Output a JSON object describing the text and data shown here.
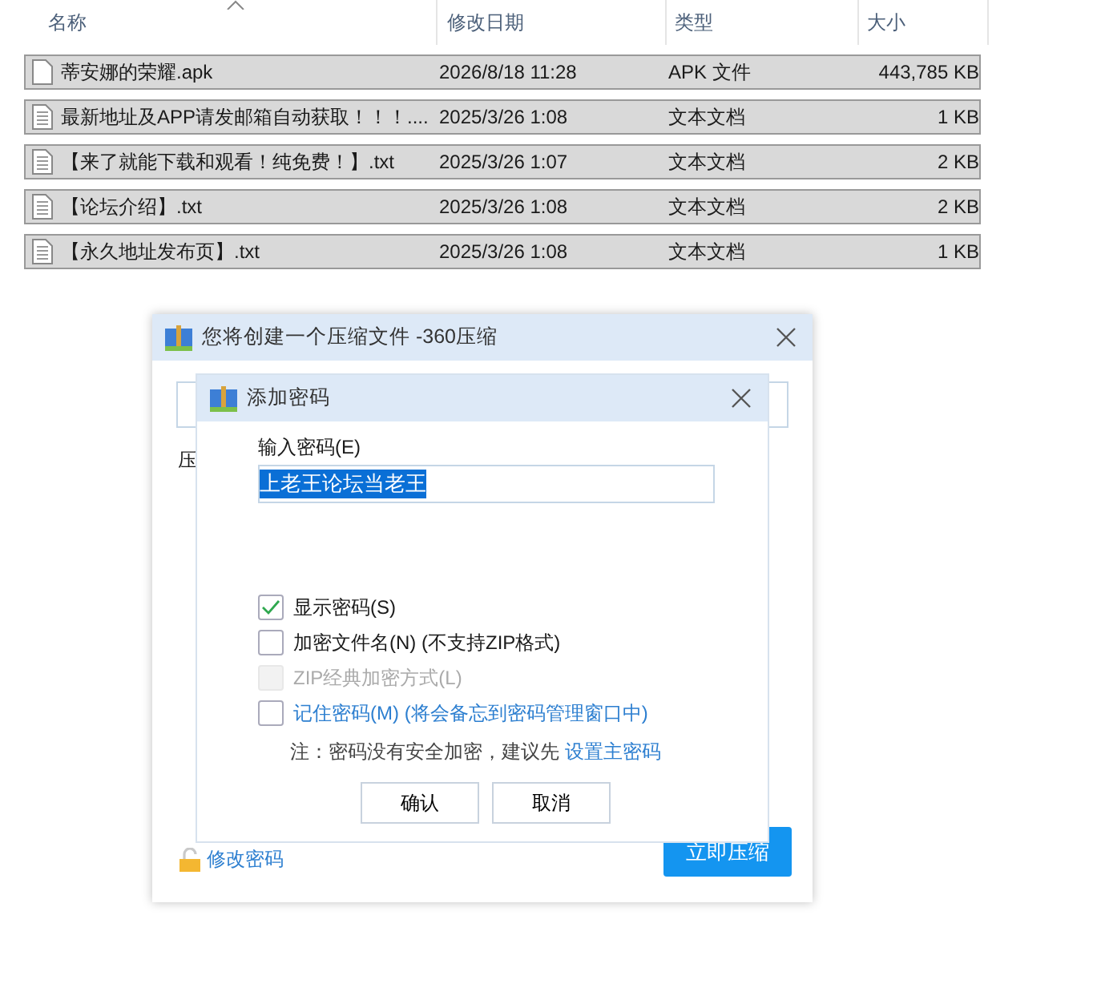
{
  "file_list": {
    "columns": [
      "名称",
      "修改日期",
      "类型",
      "大小"
    ],
    "rows": [
      {
        "name": "蒂安娜的荣耀.apk",
        "date": "2026/8/18 11:28",
        "type": "APK 文件",
        "size": "443,785 KB",
        "kind": "apk",
        "selected": true
      },
      {
        "name": "最新地址及APP请发邮箱自动获取！！！....",
        "date": "2025/3/26 1:08",
        "type": "文本文档",
        "size": "1 KB",
        "kind": "text",
        "selected": true
      },
      {
        "name": "【来了就能下载和观看！纯免费！】.txt",
        "date": "2025/3/26 1:07",
        "type": "文本文档",
        "size": "2 KB",
        "kind": "text",
        "selected": true
      },
      {
        "name": "【论坛介绍】.txt",
        "date": "2025/3/26 1:08",
        "type": "文本文档",
        "size": "2 KB",
        "kind": "text",
        "selected": true
      },
      {
        "name": "【永久地址发布页】.txt",
        "date": "2025/3/26 1:08",
        "type": "文本文档",
        "size": "1 KB",
        "kind": "text",
        "selected": true
      }
    ]
  },
  "compress_dialog": {
    "title": "您将创建一个压缩文件 -360压缩",
    "label": "压",
    "change_password_link": "修改密码",
    "compress_button": "立即压缩"
  },
  "password_dialog": {
    "title": "添加密码",
    "password_label": "输入密码(E)",
    "password_value": "上老王论坛当老王",
    "options": [
      {
        "label": "显示密码(S)",
        "checked": true,
        "disabled": false,
        "link": false
      },
      {
        "label": "加密文件名(N) (不支持ZIP格式)",
        "checked": false,
        "disabled": false,
        "link": false
      },
      {
        "label": "ZIP经典加密方式(L)",
        "checked": false,
        "disabled": true,
        "link": false
      },
      {
        "label": "记住密码(M) (将会备忘到密码管理窗口中)",
        "checked": false,
        "disabled": false,
        "link": true
      }
    ],
    "note": "注：密码没有安全加密，建议先",
    "note_link": "设置主密码",
    "buttons": [
      "确认",
      "取消"
    ]
  }
}
